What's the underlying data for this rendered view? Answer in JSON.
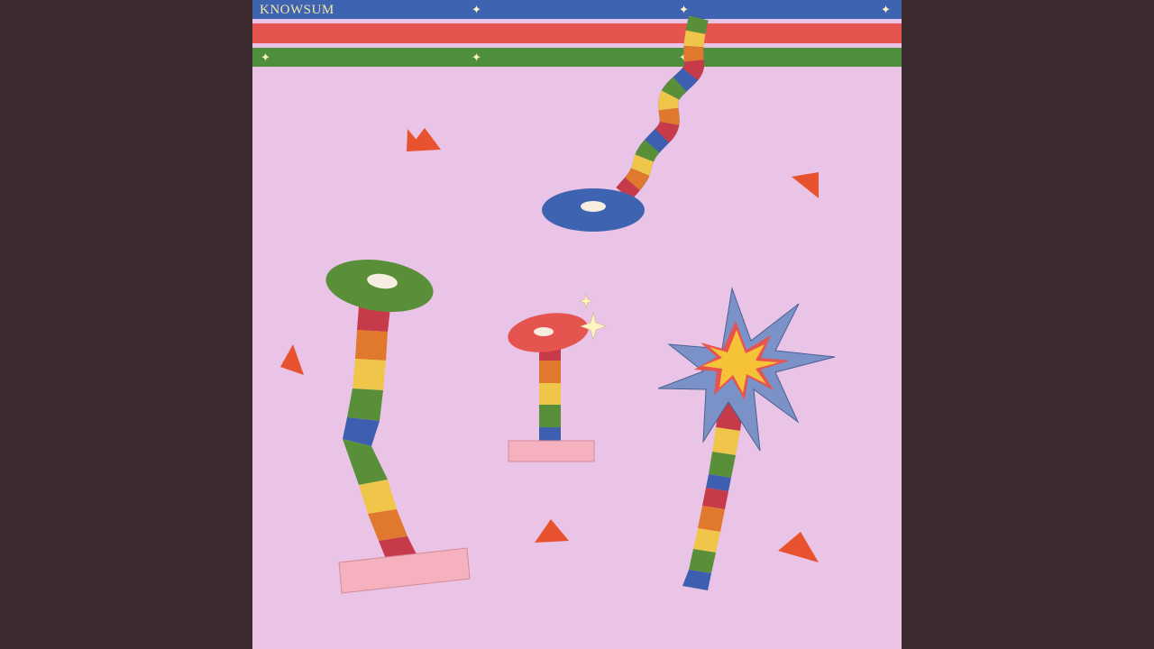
{
  "album": {
    "artist_label": "KNOWSUM"
  },
  "palette": {
    "background_outer": "#3c2b2e",
    "cover_background": "#e9c4e6",
    "band_blue": "#3e63b0",
    "band_red": "#e5544e",
    "band_green": "#4e8e3d",
    "rainbow": [
      "#c63a4a",
      "#e0782e",
      "#f0c64a",
      "#5a8f3a",
      "#3e5fb0"
    ],
    "triangle": "#e8522e",
    "pedestal": "#f6b1bf",
    "burst_outer": "#7a92c8",
    "burst_inner": "#f6c338"
  },
  "icons": {
    "band_star": "four-point-star-icon"
  }
}
